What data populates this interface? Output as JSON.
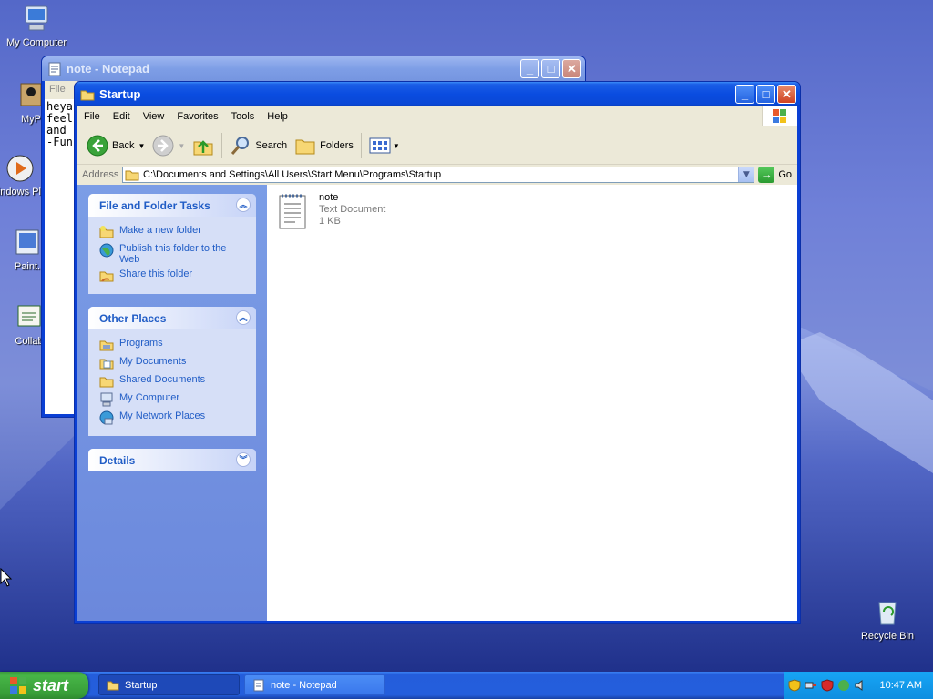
{
  "desktop": {
    "icons": [
      {
        "label": "My Computer"
      },
      {
        "label": "MyP"
      },
      {
        "label": "Windows Play"
      },
      {
        "label": "Paint."
      },
      {
        "label": "Collab"
      },
      {
        "label": "Recycle Bin"
      }
    ]
  },
  "notepad": {
    "title": "note - Notepad",
    "menu_file": "File",
    "text": "heya\nfeel\nand \n-Fun"
  },
  "explorer": {
    "title": "Startup",
    "menu": [
      "File",
      "Edit",
      "View",
      "Favorites",
      "Tools",
      "Help"
    ],
    "toolbar": {
      "back": "Back",
      "search": "Search",
      "folders": "Folders"
    },
    "address": {
      "label": "Address",
      "path": "C:\\Documents and Settings\\All Users\\Start Menu\\Programs\\Startup",
      "go": "Go"
    },
    "panels": {
      "file_tasks": {
        "title": "File and Folder Tasks",
        "items": [
          "Make a new folder",
          "Publish this folder to the Web",
          "Share this folder"
        ]
      },
      "other_places": {
        "title": "Other Places",
        "items": [
          "Programs",
          "My Documents",
          "Shared Documents",
          "My Computer",
          "My Network Places"
        ]
      },
      "details": {
        "title": "Details"
      }
    },
    "files": [
      {
        "name": "note",
        "type": "Text Document",
        "size": "1 KB"
      }
    ]
  },
  "taskbar": {
    "start": "start",
    "buttons": [
      {
        "label": "Startup"
      },
      {
        "label": "note - Notepad"
      }
    ],
    "clock": "10:47 AM"
  },
  "colors": {
    "title_active": "#0a4ce0",
    "task_link": "#215dc6",
    "start_green": "#3c9c3c"
  }
}
